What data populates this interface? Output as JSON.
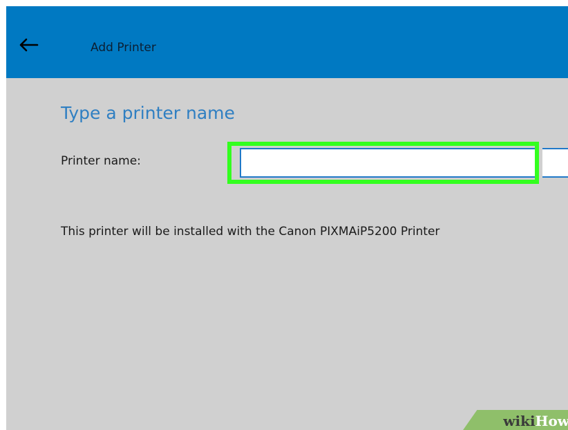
{
  "window": {
    "title": "Add Printer",
    "back_icon": "arrow-left-icon",
    "accent_color": "#0079c2"
  },
  "main": {
    "heading": "Type a printer name",
    "printer_name_label": "Printer name:",
    "printer_name_value": "",
    "info_text": "This printer will be installed with the Canon PIXMAiP5200 Printer"
  },
  "highlight_color": "#33ff1f",
  "watermark": {
    "part1": "wiki",
    "part2": "How"
  }
}
